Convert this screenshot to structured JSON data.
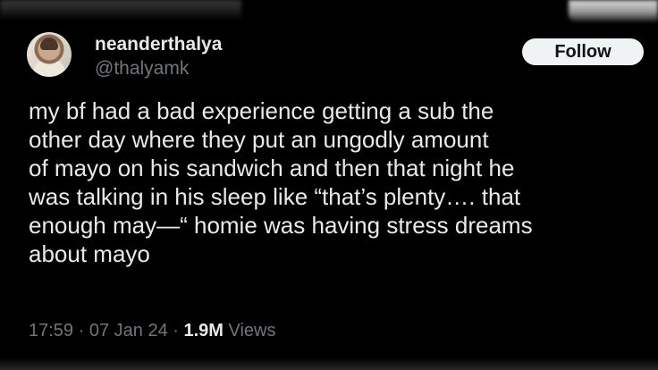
{
  "author": {
    "display_name": "neanderthalya",
    "handle": "@thalyamk"
  },
  "follow_label": "Follow",
  "tweet": {
    "text": "my bf had a bad experience getting a sub the\nother day where they put an ungodly amount\nof mayo on his sandwich and then that night he\nwas talking in his sleep like “that’s plenty…. that\nenough may—“ homie was having stress dreams\nabout mayo"
  },
  "meta": {
    "time": "17:59",
    "sep1": " · ",
    "date": "07 Jan 24",
    "sep2": " · ",
    "views_count": "1.9M",
    "views_label": " Views"
  }
}
